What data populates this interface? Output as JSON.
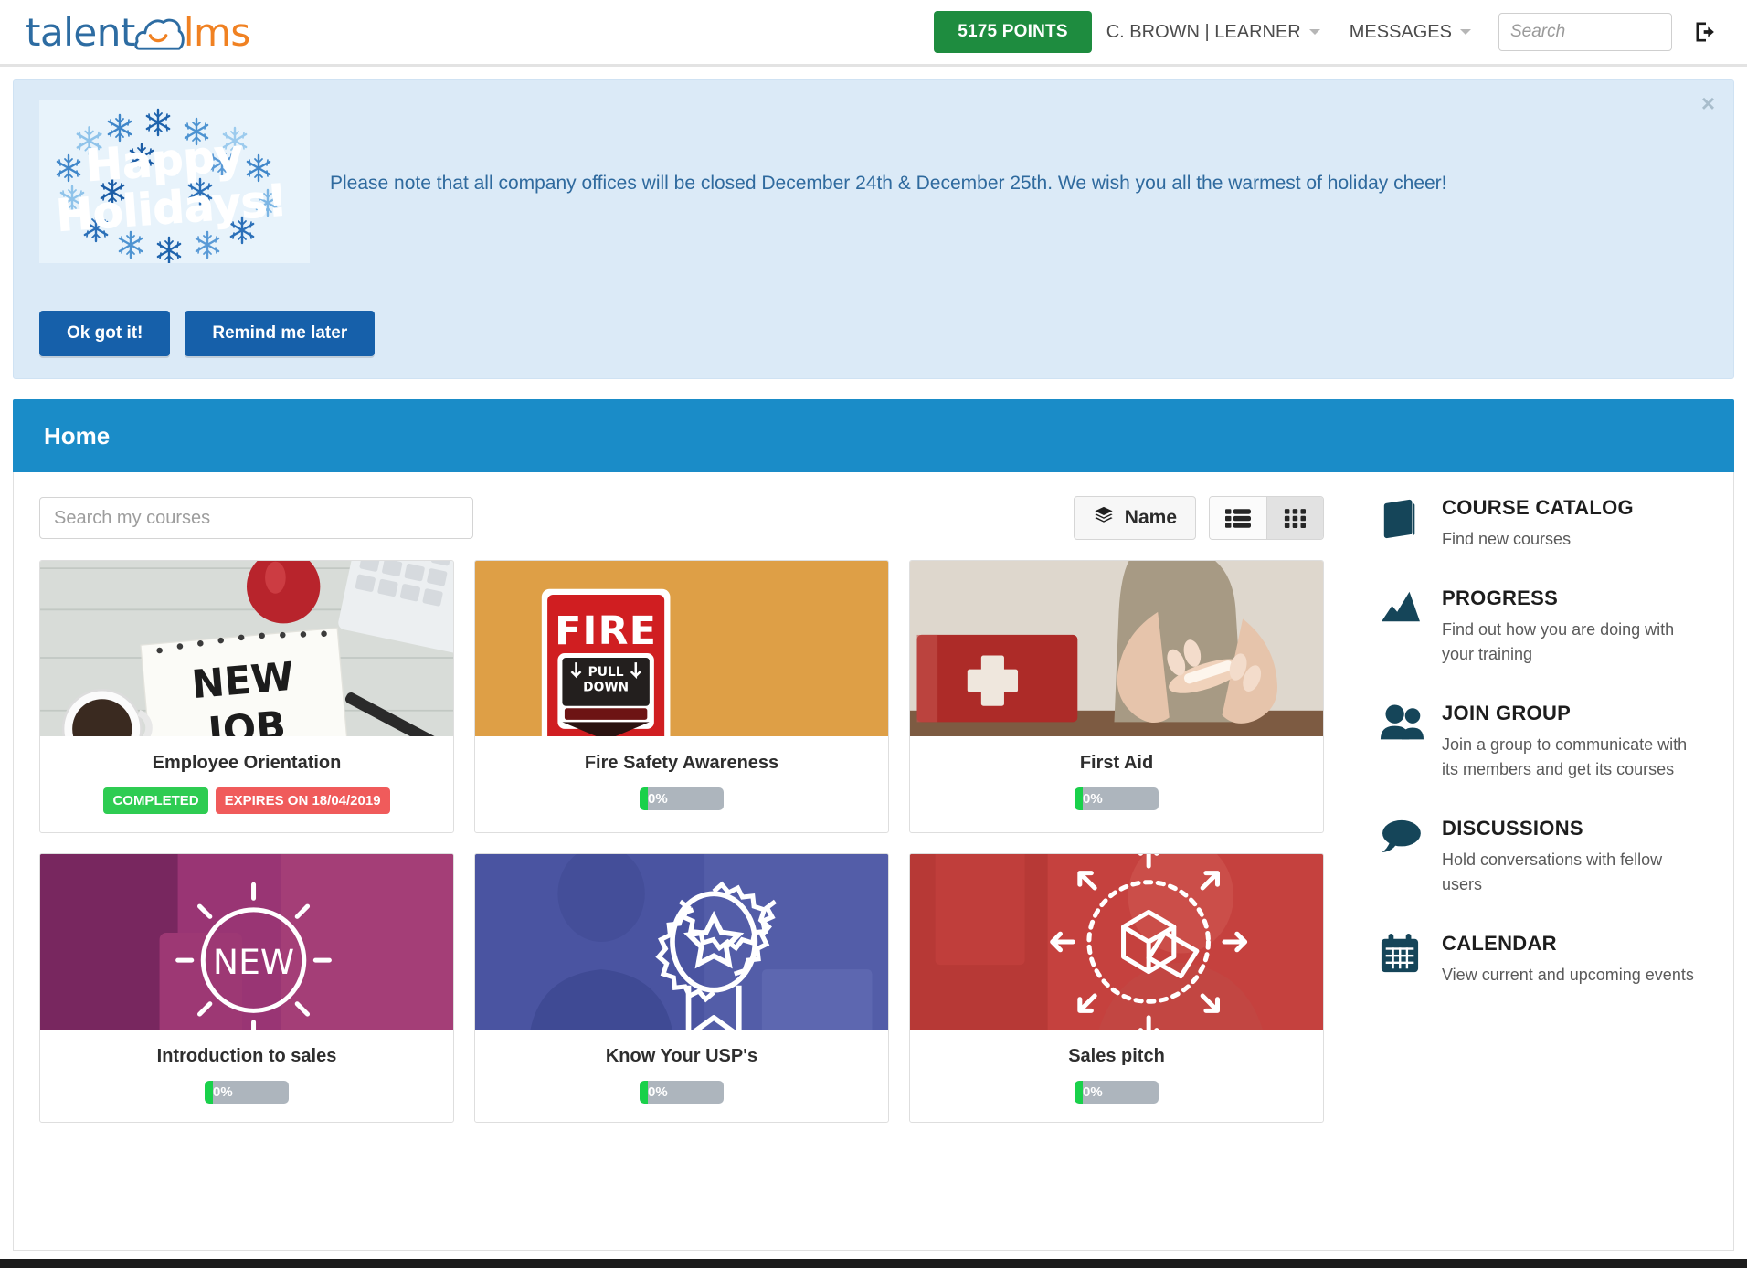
{
  "header": {
    "logo_talent": "talent",
    "logo_lms": "lms",
    "logo_cloud_icon": "cloud-smile-icon",
    "points_label": "5175 POINTS",
    "user_menu": "C. BROWN | LEARNER",
    "messages_menu": "MESSAGES",
    "search_placeholder": "Search",
    "search_value": "",
    "logout_icon": "logout-icon"
  },
  "announcement": {
    "close_label": "×",
    "image_alt": "Happy Holidays!",
    "image_line1": "Happy",
    "image_line2": "Holidays!",
    "text": "Please note that all company offices will be closed December 24th & December 25th. We wish you all the warmest of holiday cheer!",
    "ok_button": "Ok got it!",
    "remind_button": "Remind me later"
  },
  "page": {
    "title": "Home"
  },
  "toolbar": {
    "search_placeholder": "Search my courses",
    "search_value": "",
    "sort_label": "Name",
    "sort_icon": "layers-icon",
    "list_view_icon": "list-view-icon",
    "grid_view_icon": "grid-view-icon",
    "active_view": "grid"
  },
  "courses": [
    {
      "title": "Employee Orientation",
      "thumb": "new-job-notepad-photo",
      "status_badges": [
        {
          "label": "COMPLETED",
          "type": "completed"
        },
        {
          "label": "EXPIRES ON 18/04/2019",
          "type": "expires"
        }
      ],
      "progress": null
    },
    {
      "title": "Fire Safety Awareness",
      "thumb": "fire-alarm-pull-station-photo",
      "status_badges": [],
      "progress": {
        "label": "0%",
        "value": 0
      }
    },
    {
      "title": "First Aid",
      "thumb": "first-aid-kit-photo",
      "status_badges": [],
      "progress": {
        "label": "0%",
        "value": 0
      }
    },
    {
      "title": "Introduction to sales",
      "thumb": "purple-new-sunburst-overlay",
      "status_badges": [],
      "progress": {
        "label": "0%",
        "value": 0
      }
    },
    {
      "title": "Know Your USP's",
      "thumb": "blue-award-ribbon-overlay",
      "status_badges": [],
      "progress": {
        "label": "0%",
        "value": 0
      }
    },
    {
      "title": "Sales pitch",
      "thumb": "red-box-arrows-overlay",
      "status_badges": [],
      "progress": {
        "label": "0%",
        "value": 0
      }
    }
  ],
  "sidebar": {
    "items": [
      {
        "title": "COURSE CATALOG",
        "desc": "Find new courses",
        "icon": "book-icon"
      },
      {
        "title": "PROGRESS",
        "desc": "Find out how you are doing with your training",
        "icon": "chart-icon"
      },
      {
        "title": "JOIN GROUP",
        "desc": "Join a group to communicate with its members and get its courses",
        "icon": "people-icon"
      },
      {
        "title": "DISCUSSIONS",
        "desc": "Hold conversations with fellow users",
        "icon": "speech-bubble-icon"
      },
      {
        "title": "CALENDAR",
        "desc": "View current and upcoming events",
        "icon": "calendar-icon"
      }
    ]
  },
  "colors": {
    "brand_blue": "#2d6ca2",
    "brand_orange": "#f08122",
    "points_green": "#1e8c3f",
    "pagebar_blue": "#1a8cc8",
    "button_blue": "#1660aa",
    "badge_completed": "#2ecc52",
    "badge_expires": "#f05b5b",
    "progress_green": "#19d14a",
    "sidebar_icon": "#154559"
  }
}
